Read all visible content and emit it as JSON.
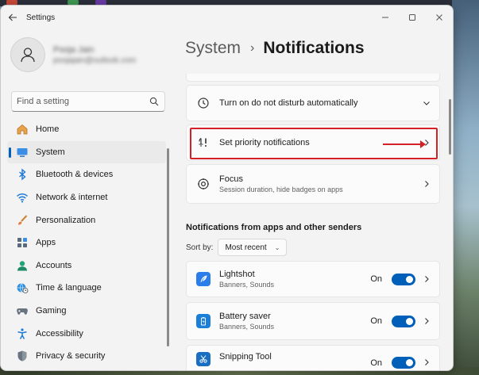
{
  "window": {
    "title": "Settings",
    "back_icon": "arrow-left-icon",
    "controls": [
      "minimize-icon",
      "maximize-icon",
      "close-icon"
    ]
  },
  "profile": {
    "name": "Pooja Jain",
    "email": "poojajain@outlook.com"
  },
  "search": {
    "placeholder": "Find a setting"
  },
  "sidebar": {
    "items": [
      {
        "label": "Home",
        "icon": "home-icon",
        "active": false
      },
      {
        "label": "System",
        "icon": "monitor-icon",
        "active": true
      },
      {
        "label": "Bluetooth & devices",
        "icon": "bluetooth-icon",
        "active": false
      },
      {
        "label": "Network & internet",
        "icon": "wifi-icon",
        "active": false
      },
      {
        "label": "Personalization",
        "icon": "brush-icon",
        "active": false
      },
      {
        "label": "Apps",
        "icon": "apps-icon",
        "active": false
      },
      {
        "label": "Accounts",
        "icon": "account-icon",
        "active": false
      },
      {
        "label": "Time & language",
        "icon": "globe-clock-icon",
        "active": false
      },
      {
        "label": "Gaming",
        "icon": "gamepad-icon",
        "active": false
      },
      {
        "label": "Accessibility",
        "icon": "accessibility-icon",
        "active": false
      },
      {
        "label": "Privacy & security",
        "icon": "shield-icon",
        "active": false
      }
    ]
  },
  "main": {
    "breadcrumb": {
      "parent": "System",
      "separator": "›",
      "current": "Notifications"
    },
    "settings": [
      {
        "title": "Turn on do not disturb automatically",
        "icon": "clock-icon",
        "control": "expand"
      },
      {
        "title": "Set priority notifications",
        "icon": "priority-bell-icon",
        "control": "navigate",
        "highlighted": true
      },
      {
        "title": "Focus",
        "subtitle": "Session duration, hide badges on apps",
        "icon": "focus-icon",
        "control": "navigate"
      }
    ],
    "apps_section": {
      "title": "Notifications from apps and other senders",
      "sort_label": "Sort by:",
      "sort_value": "Most recent",
      "apps": [
        {
          "name": "Lightshot",
          "subtitle": "Banners, Sounds",
          "toggle_label": "On",
          "on": true,
          "icon": "feather-icon",
          "icon_color": "#2b7de9"
        },
        {
          "name": "Battery saver",
          "subtitle": "Banners, Sounds",
          "toggle_label": "On",
          "on": true,
          "icon": "battery-icon",
          "icon_color": "#1a7fd8"
        },
        {
          "name": "Snipping Tool",
          "subtitle": "",
          "toggle_label": "On",
          "on": true,
          "icon": "scissors-icon",
          "icon_color": "#1a6fc2"
        }
      ]
    }
  },
  "colors": {
    "accent": "#005fb8",
    "highlight_box": "#d42027"
  }
}
